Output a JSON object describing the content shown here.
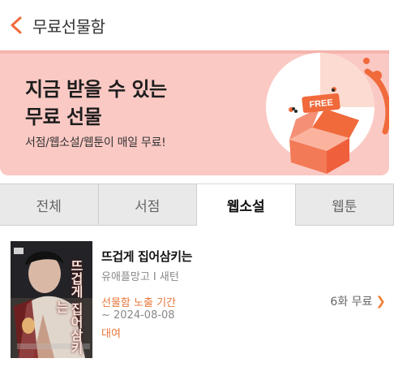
{
  "header": {
    "title": "무료선물함"
  },
  "banner": {
    "title_line1": "지금 받을 수 있는",
    "title_line2": "무료 선물",
    "subtitle": "서점/웹소설/웹툰이 매일 무료!",
    "ticket_text": "FREE",
    "accent_color": "#f06a3c"
  },
  "tabs": [
    {
      "label": "전체"
    },
    {
      "label": "서점"
    },
    {
      "label": "웹소설",
      "active": true
    },
    {
      "label": "웹툰"
    }
  ],
  "book": {
    "title": "뜨겁게 집어삼키는",
    "meta": "유애플망고 I 새턴",
    "period_label": "선물함 노출 기간",
    "period_date": "~ 2024-08-08",
    "rental": "대여",
    "free_count": "6화 무료",
    "cover_text": "뜨겁게 집어삼키는"
  }
}
